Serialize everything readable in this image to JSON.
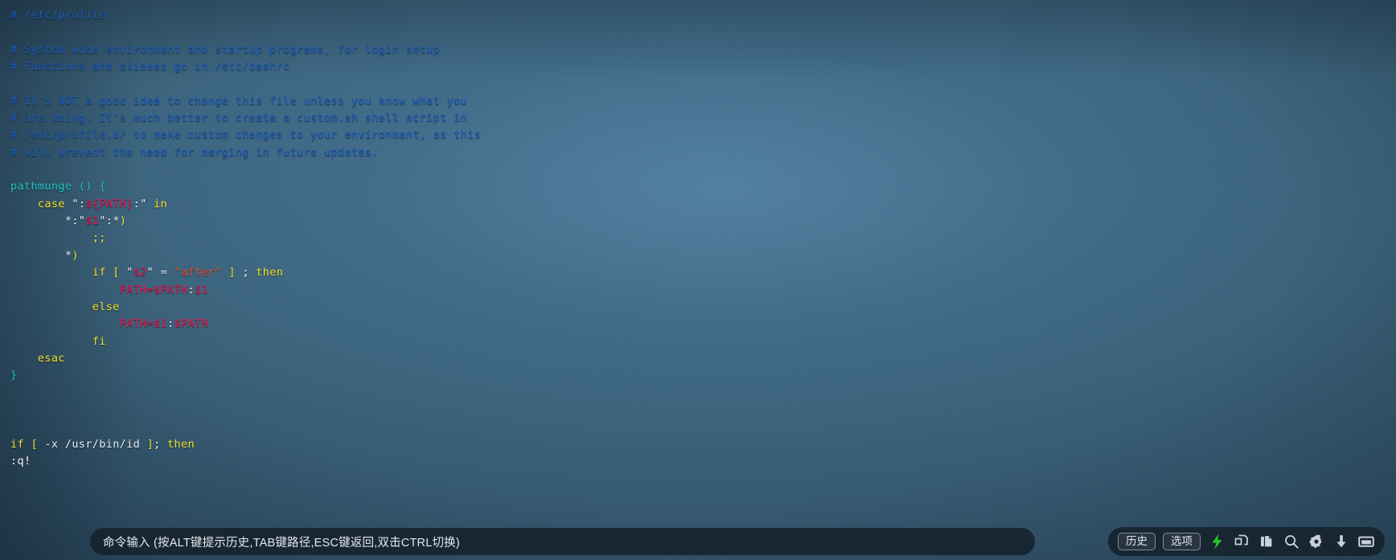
{
  "terminal": {
    "lines": [
      {
        "tokens": [
          {
            "t": "# /etc/profile",
            "c": "c-comment"
          }
        ]
      },
      {
        "tokens": []
      },
      {
        "tokens": [
          {
            "t": "# System wide environment and startup programs, for login setup",
            "c": "c-comment"
          }
        ]
      },
      {
        "tokens": [
          {
            "t": "# Functions and aliases go in /etc/bashrc",
            "c": "c-comment"
          }
        ]
      },
      {
        "tokens": []
      },
      {
        "tokens": [
          {
            "t": "# It's NOT a good idea to change this file unless you know what you",
            "c": "c-comment"
          }
        ]
      },
      {
        "tokens": [
          {
            "t": "# are doing. It's much better to create a custom.sh shell script in",
            "c": "c-comment"
          }
        ]
      },
      {
        "tokens": [
          {
            "t": "# /etc/profile.d/ to make custom changes to your environment, as this",
            "c": "c-comment"
          }
        ]
      },
      {
        "tokens": [
          {
            "t": "# will prevent the need for merging in future updates.",
            "c": "c-comment"
          }
        ]
      },
      {
        "tokens": []
      },
      {
        "tokens": [
          {
            "t": "pathmunge",
            "c": "c-func"
          },
          {
            "t": " () {",
            "c": "c-punct"
          }
        ]
      },
      {
        "tokens": [
          {
            "t": "    ",
            "c": "c-plain"
          },
          {
            "t": "case",
            "c": "c-kw"
          },
          {
            "t": " \":",
            "c": "c-plain"
          },
          {
            "t": "${PATH}",
            "c": "c-var"
          },
          {
            "t": ":\" ",
            "c": "c-plain"
          },
          {
            "t": "in",
            "c": "c-kw"
          }
        ]
      },
      {
        "tokens": [
          {
            "t": "        ",
            "c": "c-plain"
          },
          {
            "t": "*",
            "c": "c-plain"
          },
          {
            "t": ":\"",
            "c": "c-plain"
          },
          {
            "t": "$1",
            "c": "c-var"
          },
          {
            "t": "\":",
            "c": "c-plain"
          },
          {
            "t": "*",
            "c": "c-plain"
          },
          {
            "t": ")",
            "c": "c-kw"
          }
        ]
      },
      {
        "tokens": [
          {
            "t": "            ",
            "c": "c-plain"
          },
          {
            "t": ";;",
            "c": "c-kw"
          }
        ]
      },
      {
        "tokens": [
          {
            "t": "        ",
            "c": "c-plain"
          },
          {
            "t": "*",
            "c": "c-plain"
          },
          {
            "t": ")",
            "c": "c-kw"
          }
        ]
      },
      {
        "tokens": [
          {
            "t": "            ",
            "c": "c-plain"
          },
          {
            "t": "if",
            "c": "c-kw"
          },
          {
            "t": " ",
            "c": "c-plain"
          },
          {
            "t": "[",
            "c": "c-kw"
          },
          {
            "t": " \"",
            "c": "c-plain"
          },
          {
            "t": "$2",
            "c": "c-var"
          },
          {
            "t": "\" = ",
            "c": "c-plain"
          },
          {
            "t": "\"after\"",
            "c": "c-str"
          },
          {
            "t": " ",
            "c": "c-plain"
          },
          {
            "t": "]",
            "c": "c-kw"
          },
          {
            "t": " ; ",
            "c": "c-plain"
          },
          {
            "t": "then",
            "c": "c-kw"
          }
        ]
      },
      {
        "tokens": [
          {
            "t": "                ",
            "c": "c-plain"
          },
          {
            "t": "PATH=$PATH",
            "c": "c-var"
          },
          {
            "t": ":",
            "c": "c-plain"
          },
          {
            "t": "$1",
            "c": "c-var"
          }
        ]
      },
      {
        "tokens": [
          {
            "t": "            ",
            "c": "c-plain"
          },
          {
            "t": "else",
            "c": "c-kw"
          }
        ]
      },
      {
        "tokens": [
          {
            "t": "                ",
            "c": "c-plain"
          },
          {
            "t": "PATH=$1",
            "c": "c-var"
          },
          {
            "t": ":",
            "c": "c-plain"
          },
          {
            "t": "$PATH",
            "c": "c-var"
          }
        ]
      },
      {
        "tokens": [
          {
            "t": "            ",
            "c": "c-plain"
          },
          {
            "t": "fi",
            "c": "c-kw"
          }
        ]
      },
      {
        "tokens": [
          {
            "t": "    ",
            "c": "c-plain"
          },
          {
            "t": "esac",
            "c": "c-kw"
          }
        ]
      },
      {
        "tokens": [
          {
            "t": "}",
            "c": "c-punct"
          }
        ]
      },
      {
        "tokens": []
      },
      {
        "tokens": []
      },
      {
        "tokens": []
      },
      {
        "tokens": [
          {
            "t": "if",
            "c": "c-kw"
          },
          {
            "t": " ",
            "c": "c-plain"
          },
          {
            "t": "[",
            "c": "c-kw"
          },
          {
            "t": " -x /usr/bin/id ",
            "c": "c-plain"
          },
          {
            "t": "]",
            "c": "c-kw"
          },
          {
            "t": "; ",
            "c": "c-plain"
          },
          {
            "t": "then",
            "c": "c-kw"
          }
        ]
      },
      {
        "tokens": [
          {
            "t": ":q!",
            "c": "c-white"
          }
        ]
      }
    ]
  },
  "command_bar": {
    "input": {
      "value": "",
      "placeholder": "命令输入 (按ALT键提示历史,TAB键路径,ESC键返回,双击CTRL切换)"
    },
    "buttons": [
      {
        "name": "history-button",
        "label": "历史"
      },
      {
        "name": "options-button",
        "label": "选项"
      }
    ],
    "icons": [
      {
        "name": "lightning-bolt-icon",
        "label": "quick-keys",
        "color": "#23c923"
      },
      {
        "name": "copy-icon",
        "label": "copy",
        "color": "#c9d2d9"
      },
      {
        "name": "paste-icon",
        "label": "paste",
        "color": "#c9d2d9"
      },
      {
        "name": "search-icon",
        "label": "search",
        "color": "#c9d2d9"
      },
      {
        "name": "gear-icon",
        "label": "settings",
        "color": "#c9d2d9"
      },
      {
        "name": "download-arrow-icon",
        "label": "download",
        "color": "#c9d2d9"
      },
      {
        "name": "window-icon",
        "label": "window",
        "color": "#c9d2d9"
      }
    ]
  },
  "colors": {
    "background_center": "#44708f",
    "background_edge": "#22384a",
    "comment": "#1a5bbf",
    "function": "#21c4c4",
    "keyword": "#f3e02a",
    "variable": "#f0114b",
    "string": "#f04b2a",
    "plain": "#e8eef2",
    "bar_background": "#16222d",
    "accent_green": "#23c923"
  }
}
